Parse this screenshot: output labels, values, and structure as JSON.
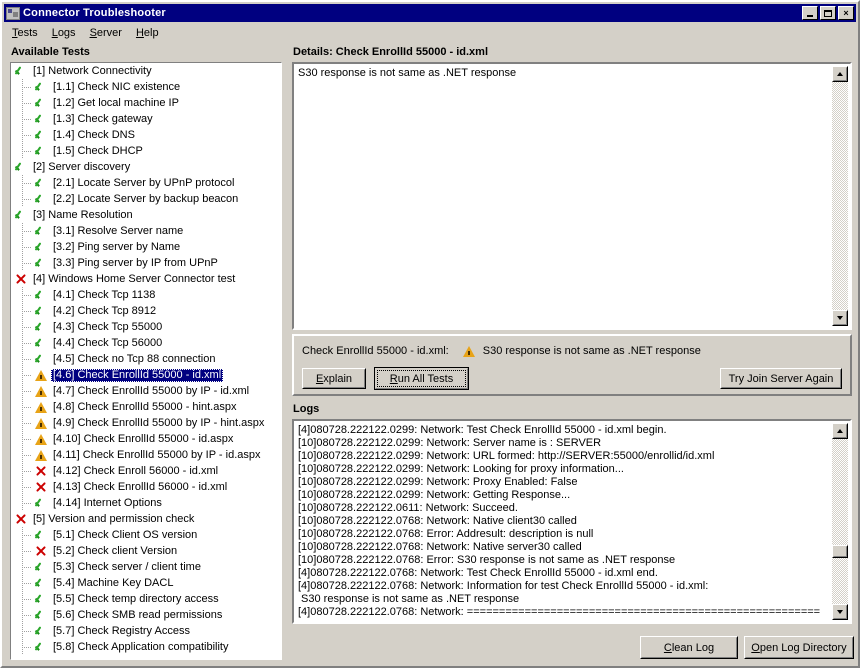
{
  "window": {
    "title": "Connector Troubleshooter",
    "minimize_label": "Minimize",
    "maximize_label": "Maximize",
    "close_label": "×"
  },
  "menu": [
    {
      "label": "Tests",
      "accel": "T"
    },
    {
      "label": "Logs",
      "accel": "L"
    },
    {
      "label": "Server",
      "accel": "S"
    },
    {
      "label": "Help",
      "accel": "H"
    }
  ],
  "left_panel": {
    "group_label": "Available Tests",
    "tests": [
      {
        "level": 0,
        "status": "ok",
        "label": "[1] Network Connectivity"
      },
      {
        "level": 1,
        "status": "ok",
        "label": "[1.1] Check NIC existence"
      },
      {
        "level": 1,
        "status": "ok",
        "label": "[1.2] Get local machine IP"
      },
      {
        "level": 1,
        "status": "ok",
        "label": "[1.3] Check gateway"
      },
      {
        "level": 1,
        "status": "ok",
        "label": "[1.4] Check DNS"
      },
      {
        "level": 1,
        "status": "ok",
        "label": "[1.5] Check DHCP"
      },
      {
        "level": 0,
        "status": "ok",
        "label": "[2] Server discovery"
      },
      {
        "level": 1,
        "status": "ok",
        "label": "[2.1] Locate Server by UPnP protocol"
      },
      {
        "level": 1,
        "status": "ok",
        "label": "[2.2] Locate Server by backup beacon"
      },
      {
        "level": 0,
        "status": "ok",
        "label": "[3] Name Resolution"
      },
      {
        "level": 1,
        "status": "ok",
        "label": "[3.1] Resolve Server name"
      },
      {
        "level": 1,
        "status": "ok",
        "label": "[3.2] Ping server by Name"
      },
      {
        "level": 1,
        "status": "ok",
        "label": "[3.3] Ping server by IP from UPnP"
      },
      {
        "level": 0,
        "status": "fail",
        "label": "[4] Windows Home Server Connector test"
      },
      {
        "level": 1,
        "status": "ok",
        "label": "[4.1] Check Tcp 1138"
      },
      {
        "level": 1,
        "status": "ok",
        "label": "[4.2] Check Tcp 8912"
      },
      {
        "level": 1,
        "status": "ok",
        "label": "[4.3] Check Tcp 55000"
      },
      {
        "level": 1,
        "status": "ok",
        "label": "[4.4] Check Tcp 56000"
      },
      {
        "level": 1,
        "status": "ok",
        "label": "[4.5] Check no Tcp 88 connection"
      },
      {
        "level": 1,
        "status": "warn",
        "label": "[4.6] Check EnrollId 55000 - id.xml",
        "selected": true
      },
      {
        "level": 1,
        "status": "warn",
        "label": "[4.7] Check EnrollId 55000 by IP - id.xml"
      },
      {
        "level": 1,
        "status": "warn",
        "label": "[4.8] Check EnrollId 55000 - hint.aspx"
      },
      {
        "level": 1,
        "status": "warn",
        "label": "[4.9] Check EnrollId 55000 by IP - hint.aspx"
      },
      {
        "level": 1,
        "status": "warn",
        "label": "[4.10] Check EnrollId 55000 - id.aspx"
      },
      {
        "level": 1,
        "status": "warn",
        "label": "[4.11] Check EnrollId 55000 by IP - id.aspx"
      },
      {
        "level": 1,
        "status": "fail",
        "label": "[4.12] Check Enroll 56000 - id.xml"
      },
      {
        "level": 1,
        "status": "fail",
        "label": "[4.13] Check EnrollId 56000 - id.xml"
      },
      {
        "level": 1,
        "status": "ok",
        "label": "[4.14] Internet Options"
      },
      {
        "level": 0,
        "status": "fail",
        "label": "[5] Version and permission check"
      },
      {
        "level": 1,
        "status": "ok",
        "label": "[5.1] Check Client OS version"
      },
      {
        "level": 1,
        "status": "fail",
        "label": "[5.2] Check client Version"
      },
      {
        "level": 1,
        "status": "ok",
        "label": "[5.3] Check server / client time"
      },
      {
        "level": 1,
        "status": "ok",
        "label": "[5.4] Machine Key DACL"
      },
      {
        "level": 1,
        "status": "ok",
        "label": "[5.5] Check temp directory access"
      },
      {
        "level": 1,
        "status": "ok",
        "label": "[5.6] Check SMB read permissions"
      },
      {
        "level": 1,
        "status": "ok",
        "label": "[5.7] Check Registry Access"
      },
      {
        "level": 1,
        "status": "ok",
        "label": "[5.8] Check Application compatibility"
      }
    ]
  },
  "details": {
    "header": "Details: Check EnrollId 55000 - id.xml",
    "body": "S30 response is not same as .NET response"
  },
  "status_strip": {
    "test_name": "Check EnrollId 55000 - id.xml:",
    "message": "S30 response is not same as .NET response",
    "explain_label": "Explain",
    "explain_accel": "E",
    "run_all_label": "Run All Tests",
    "run_all_accel": "R",
    "try_join_label": "Try Join Server Again"
  },
  "logs": {
    "group_label": "Logs",
    "lines": [
      "[4]080728.222122.0299: Network: Test Check EnrollId 55000 - id.xml begin.",
      "[10]080728.222122.0299: Network: Server name is : SERVER",
      "[10]080728.222122.0299: Network: URL formed: http://SERVER:55000/enrollid/id.xml",
      "[10]080728.222122.0299: Network: Looking for proxy information...",
      "[10]080728.222122.0299: Network: Proxy Enabled: False",
      "[10]080728.222122.0299: Network: Getting Response...",
      "[10]080728.222122.0611: Network: Succeed.",
      "[10]080728.222122.0768: Network: Native client30 called",
      "[10]080728.222122.0768: Error: Addresult: description is null",
      "[10]080728.222122.0768: Network: Native server30 called",
      "[10]080728.222122.0768: Error: S30 response is not same as .NET response",
      "[4]080728.222122.0768: Network: Test Check EnrollId 55000 - id.xml end.",
      "[4]080728.222122.0768: Network: Information for test Check EnrollId 55000 - id.xml:",
      " S30 response is not same as .NET response",
      "[4]080728.222122.0768: Network: ======================================================="
    ],
    "clean_log_label": "Clean Log",
    "clean_log_accel": "C",
    "open_log_dir_label": "Open Log Directory",
    "open_log_dir_accel": "O"
  },
  "colors": {
    "titlebar": "#000080",
    "face": "#d4d0c8",
    "ok": "#2aa82a",
    "fail": "#cc0000",
    "warn": "#e8a317",
    "selection": "#000080"
  }
}
